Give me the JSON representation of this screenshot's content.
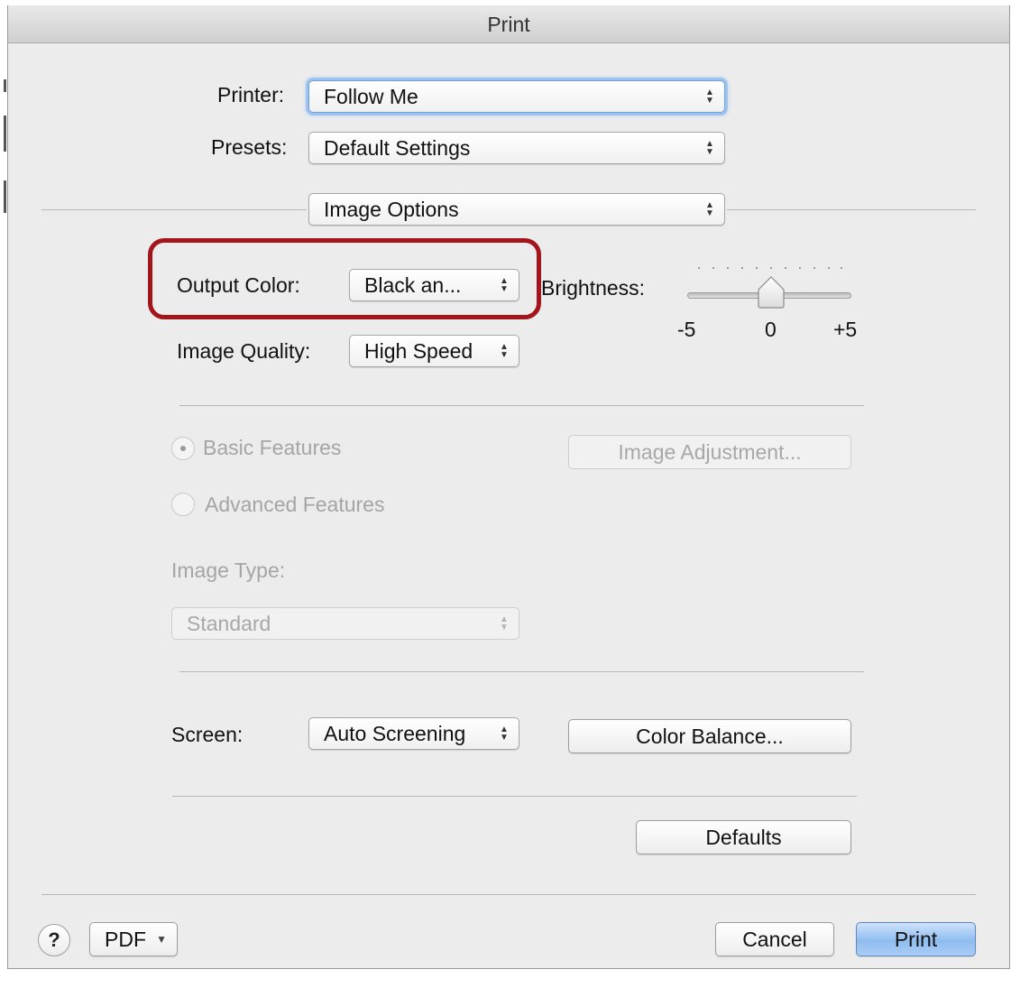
{
  "window": {
    "title": "Print"
  },
  "printer": {
    "label": "Printer:",
    "value": "Follow Me"
  },
  "presets": {
    "label": "Presets:",
    "value": "Default Settings"
  },
  "panel": {
    "value": "Image Options"
  },
  "output_color": {
    "label": "Output Color:",
    "value": "Black an..."
  },
  "brightness": {
    "label": "Brightness:",
    "min_label": "-5",
    "mid_label": "0",
    "max_label": "+5",
    "value": 0,
    "range": [
      -5,
      5
    ]
  },
  "image_quality": {
    "label": "Image Quality:",
    "value": "High Speed"
  },
  "features": {
    "basic": "Basic Features",
    "advanced": "Advanced Features",
    "selected": "basic",
    "enabled": false
  },
  "image_adjustment": {
    "label": "Image Adjustment..."
  },
  "image_type": {
    "label": "Image Type:",
    "value": "Standard"
  },
  "screen": {
    "label": "Screen:",
    "value": "Auto Screening"
  },
  "color_balance": {
    "label": "Color Balance..."
  },
  "defaults": {
    "label": "Defaults"
  },
  "footer": {
    "help": "?",
    "pdf": "PDF",
    "cancel": "Cancel",
    "print": "Print"
  },
  "colors": {
    "highlight": "#a3151a",
    "primary_button": "#8fbcf0",
    "focus_ring": "#9dc3ee",
    "disabled_text": "#a5a5a5"
  },
  "icons": {
    "popup_arrows": "updown-arrows-icon",
    "pdf_menu": "chevron-down-icon",
    "help": "question-mark-icon"
  }
}
